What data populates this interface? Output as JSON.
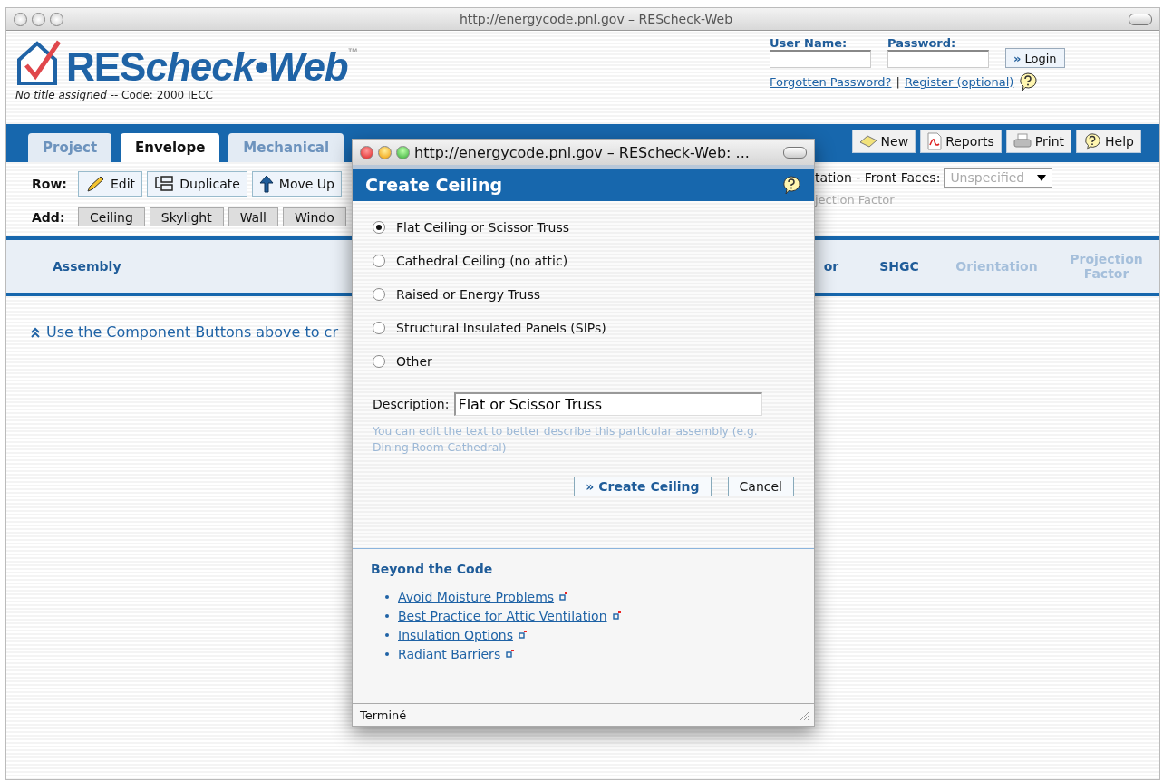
{
  "window": {
    "title": "http://energycode.pnl.gov – REScheck-Web"
  },
  "header": {
    "logo_main": "RES",
    "logo_script": "check•Web",
    "logo_mark": "™",
    "subtitle": "*No title assigned* -- Code: 2000 IECC",
    "login": {
      "user_label": "User Name:",
      "password_label": "Password:",
      "login_icon": "»",
      "login_button": "Login",
      "forgot_link": "Forgotten Password?",
      "separator": "|",
      "register_link": "Register (optional)"
    }
  },
  "tabs": [
    {
      "label": "Project",
      "selected": false
    },
    {
      "label": "Envelope",
      "selected": true
    },
    {
      "label": "Mechanical",
      "selected": false
    }
  ],
  "toolbar": [
    {
      "label": "New",
      "kind": "new"
    },
    {
      "label": "Reports",
      "kind": "pdf"
    },
    {
      "label": "Print",
      "kind": "print"
    },
    {
      "label": "Help",
      "kind": "help"
    }
  ],
  "row_actions": {
    "label": "Row:",
    "buttons": [
      {
        "label": "Edit",
        "kind": "edit"
      },
      {
        "label": "Duplicate",
        "kind": "duplicate"
      },
      {
        "label": "Move Up",
        "kind": "up"
      }
    ]
  },
  "add_actions": {
    "label": "Add:",
    "buttons": [
      "Ceiling",
      "Skylight",
      "Wall",
      "Windo"
    ]
  },
  "orientation": {
    "label": "tation - Front Faces:",
    "value": "Unspecified",
    "disabled": true,
    "note": "jection Factor"
  },
  "table": {
    "columns": [
      {
        "label": "Assembly",
        "disabled": false
      },
      {
        "label": "or",
        "disabled": false
      },
      {
        "label": "SHGC",
        "disabled": false
      },
      {
        "label": "Orientation",
        "disabled": true
      },
      {
        "label": "Projection Factor",
        "disabled": true
      }
    ],
    "empty_message": "Use the Component Buttons above to cr"
  },
  "popup": {
    "title": "http://energycode.pnl.gov – REScheck-Web: ...",
    "heading": "Create Ceiling",
    "options": [
      {
        "label": "Flat Ceiling or Scissor Truss",
        "selected": true
      },
      {
        "label": "Cathedral Ceiling (no attic)",
        "selected": false
      },
      {
        "label": "Raised or Energy Truss",
        "selected": false
      },
      {
        "label": "Structural Insulated Panels (SIPs)",
        "selected": false
      },
      {
        "label": "Other",
        "selected": false
      }
    ],
    "description_label": "Description:",
    "description_value": "Flat or Scissor Truss",
    "hint": "You can edit the text to better describe this particular assembly (e.g. Dining Room Cathedral)",
    "create_icon": "»",
    "create_button": "Create Ceiling",
    "cancel_button": "Cancel",
    "beyond_heading": "Beyond the Code",
    "links": [
      "Avoid Moisture Problems",
      "Best Practice for Attic Ventilation",
      "Insulation Options",
      "Radiant Barriers"
    ],
    "status": "Terminé"
  }
}
